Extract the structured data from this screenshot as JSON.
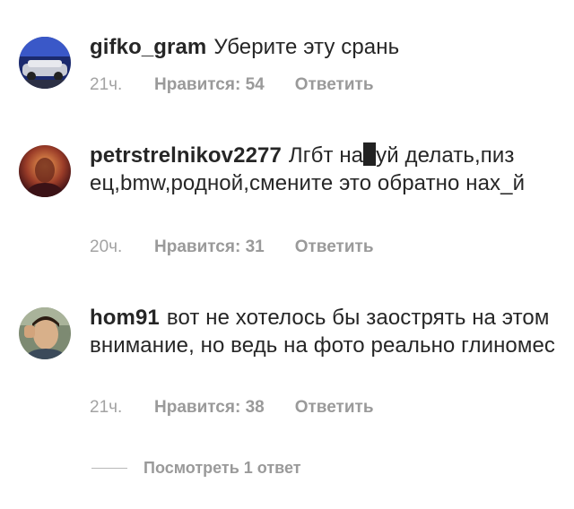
{
  "comments": [
    {
      "username": "gifko_gram",
      "text": "Уберите эту срань",
      "time": "21ч.",
      "likes": "Нравится: 54",
      "reply": "Ответить"
    },
    {
      "username": "petrstrelnikov2277",
      "text_a": "Лгбт на",
      "text_b": "уй делать,пиз     ец,bmw,родной,смените это обратно нах_й",
      "time": "20ч.",
      "likes": "Нравится: 31",
      "reply": "Ответить"
    },
    {
      "username": "hom91",
      "text": "вот не хотелось бы заострять на этом внимание, но ведь на фото реально глиномес",
      "time": "21ч.",
      "likes": "Нравится: 38",
      "reply": "Ответить"
    }
  ],
  "view_replies": "Посмотреть 1 ответ"
}
